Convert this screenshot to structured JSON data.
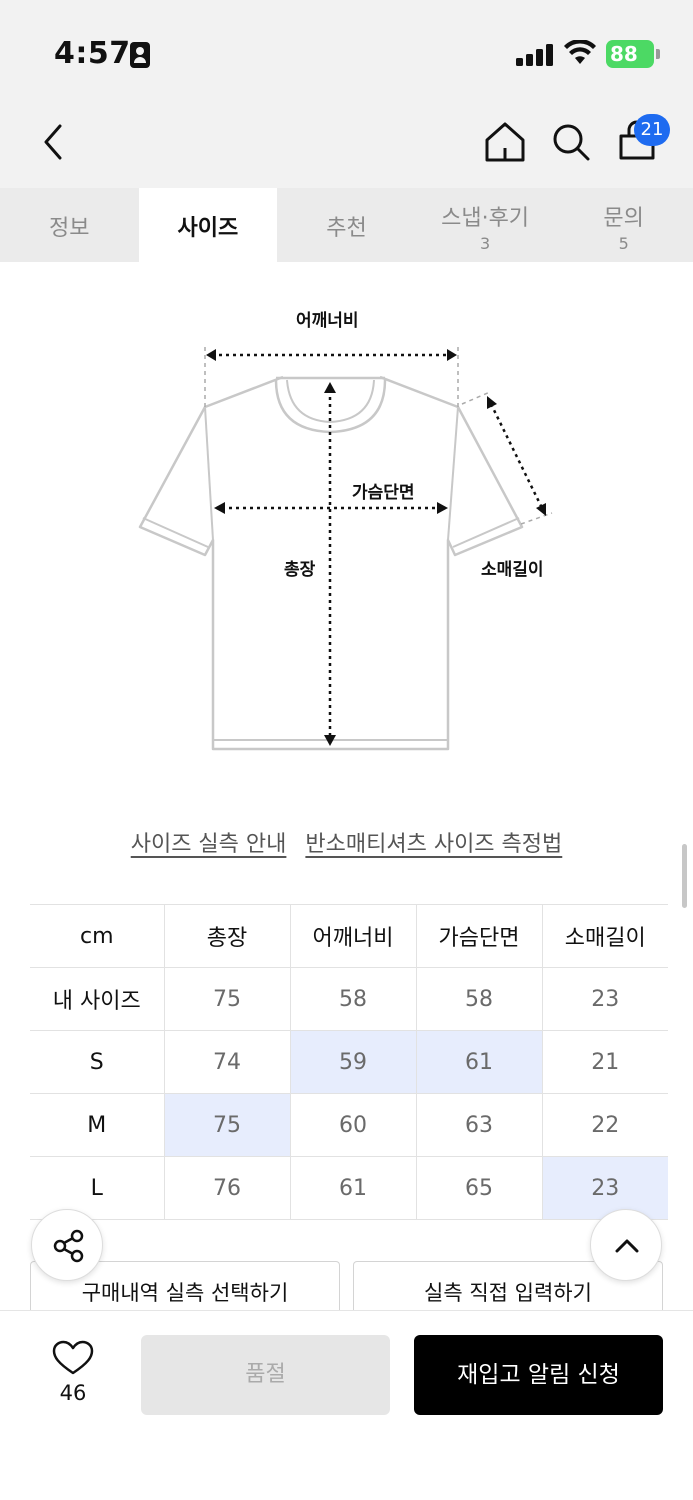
{
  "status_bar": {
    "time": "4:57",
    "battery": "88"
  },
  "header": {
    "cart_count": "21"
  },
  "tabs": [
    {
      "label": "정보",
      "count": ""
    },
    {
      "label": "사이즈",
      "count": ""
    },
    {
      "label": "추천",
      "count": ""
    },
    {
      "label": "스냅·후기",
      "count": "3"
    },
    {
      "label": "문의",
      "count": "5"
    }
  ],
  "diagram": {
    "shoulder": "어깨너비",
    "chest": "가슴단면",
    "length": "총장",
    "sleeve": "소매길이"
  },
  "links": {
    "guide": "사이즈 실측 안내",
    "measure": "반소매티셔츠 사이즈 측정법"
  },
  "size_table": {
    "headers": [
      "cm",
      "총장",
      "어깨너비",
      "가슴단면",
      "소매길이"
    ],
    "rows": [
      {
        "label": "내 사이즈",
        "values": [
          "75",
          "58",
          "58",
          "23"
        ]
      },
      {
        "label": "S",
        "values": [
          "74",
          "59",
          "61",
          "21"
        ]
      },
      {
        "label": "M",
        "values": [
          "75",
          "60",
          "63",
          "22"
        ]
      },
      {
        "label": "L",
        "values": [
          "76",
          "61",
          "65",
          "23"
        ]
      }
    ]
  },
  "buttons": {
    "purchase_history": "구매내역 실측 선택하기",
    "direct_input": "실측 직접 입력하기",
    "sold_out": "품절",
    "restock": "재입고 알림 신청"
  },
  "like": {
    "count": "46"
  },
  "colors": {
    "highlight": "#e7edfd",
    "badge": "#1e6bf0",
    "battery": "#4cd964"
  }
}
